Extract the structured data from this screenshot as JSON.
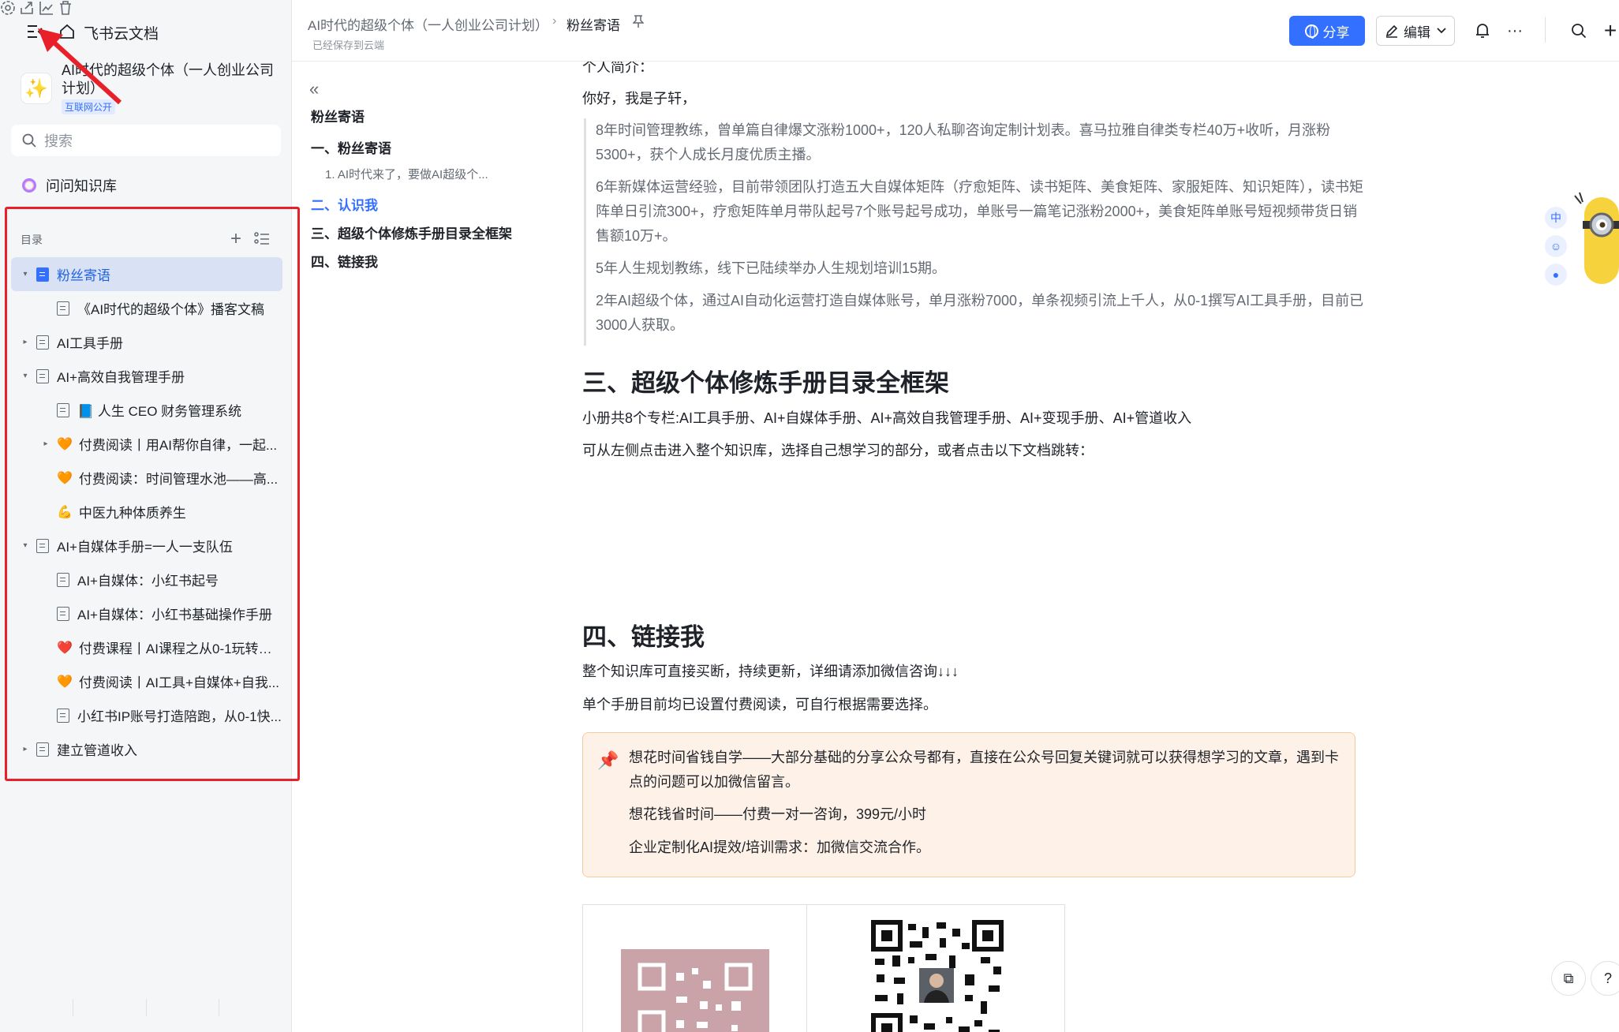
{
  "app": {
    "name": "飞书云文档"
  },
  "space": {
    "title": "AI时代的超级个体（一人创业公司计划）",
    "badge": "互联网公开"
  },
  "search": {
    "placeholder": "搜索"
  },
  "ai_kb": {
    "label": "问问知识库"
  },
  "toc": {
    "header": "目录",
    "items": [
      {
        "label": "粉丝寄语",
        "level": 0,
        "expanded": true,
        "active": true,
        "icon": "doc-blue"
      },
      {
        "label": "《AI时代的超级个体》播客文稿",
        "level": 1,
        "icon": "doc"
      },
      {
        "label": "AI工具手册",
        "level": 0,
        "expanded": false,
        "icon": "doc"
      },
      {
        "label": "AI+高效自我管理手册",
        "level": 0,
        "expanded": true,
        "icon": "doc"
      },
      {
        "label": "📘 人生 CEO 财务管理系统",
        "level": 1,
        "icon": "doc"
      },
      {
        "label": "付费阅读丨用AI帮你自律，一起...",
        "level": 1,
        "expanded": false,
        "icon": "orange-heart"
      },
      {
        "label": "付费阅读：时间管理水池——高...",
        "level": 1,
        "icon": "orange-heart"
      },
      {
        "label": "中医九种体质养生",
        "level": 1,
        "icon": "flex-arm"
      },
      {
        "label": "AI+自媒体手册=一人一支队伍",
        "level": 0,
        "expanded": true,
        "icon": "doc"
      },
      {
        "label": "AI+自媒体：小红书起号",
        "level": 1,
        "icon": "doc"
      },
      {
        "label": "AI+自媒体：小红书基础操作手册",
        "level": 1,
        "icon": "doc"
      },
      {
        "label": "付费课程丨AI课程之从0-1玩转自...",
        "level": 1,
        "icon": "red-heart"
      },
      {
        "label": "付费阅读丨AI工具+自媒体+自我...",
        "level": 1,
        "icon": "orange-heart"
      },
      {
        "label": "小红书IP账号打造陪跑，从0-1快...",
        "level": 1,
        "icon": "doc"
      },
      {
        "label": "建立管道收入",
        "level": 0,
        "expanded": false,
        "icon": "doc"
      }
    ]
  },
  "topbar": {
    "breadcrumb_parent": "AI时代的超级个体（一人创业公司计划）",
    "breadcrumb_current": "粉丝寄语",
    "saved_status": "已经保存到云端",
    "share_label": "分享",
    "edit_label": "编辑"
  },
  "outline": {
    "title": "粉丝寄语",
    "items": [
      {
        "label": "一、粉丝寄语",
        "type": "h"
      },
      {
        "label": "1. AI时代来了，要做AI超级个...",
        "type": "sub"
      },
      {
        "label": "二、认识我",
        "type": "h",
        "active": true
      },
      {
        "label": "三、超级个体修炼手册目录全框架",
        "type": "h"
      },
      {
        "label": "四、链接我",
        "type": "h"
      }
    ]
  },
  "doc": {
    "intro_heading": "个人简介：",
    "greeting": "你好，我是子轩，",
    "quotes": [
      "8年时间管理教练，曾单篇自律爆文涨粉1000+，120人私聊咨询定制计划表。喜马拉雅自律类专栏40万+收听，月涨粉5300+，获个人成长月度优质主播。",
      "6年新媒体运营经验，目前带领团队打造五大自媒体矩阵（疗愈矩阵、读书矩阵、美食矩阵、家服矩阵、知识矩阵），读书矩阵单日引流300+，疗愈矩阵单月带队起号7个账号起号成功，单账号一篇笔记涨粉2000+，美食矩阵单账号短视频带货日销售额10万+。",
      "5年人生规划教练，线下已陆续举办人生规划培训15期。",
      "2年AI超级个体，通过AI自动化运营打造自媒体账号，单月涨粉7000，单条视频引流上千人，从0-1撰写AI工具手册，目前已3000人获取。"
    ],
    "section3_title": "三、超级个体修炼手册目录全框架",
    "section3_p1": "小册共8个专栏:AI工具手册、AI+自媒体手册、AI+高效自我管理手册、AI+变现手册、AI+管道收入",
    "section3_p2": "可从左侧点击进入整个知识库，选择自己想学习的部分，或者点击以下文档跳转：",
    "section4_title": "四、链接我",
    "section4_p1": "整个知识库可直接买断，持续更新，详细请添加微信咨询↓↓↓",
    "section4_p2": "单个手册目前均已设置付费阅读，可自行根据需要选择。",
    "callout": [
      "想花时间省钱自学——大部分基础的分享公众号都有，直接在公众号回复关键词就可以获得想学习的文章，遇到卡点的问题可以加微信留言。",
      "想花钱省时间——付费一对一咨询，399元/小时",
      "企业定制化AI提效/培训需求：加微信交流合作。"
    ]
  },
  "colors": {
    "accent": "#3370ff",
    "annotation": "#e8202a",
    "callout_bg": "#fef1e7"
  }
}
